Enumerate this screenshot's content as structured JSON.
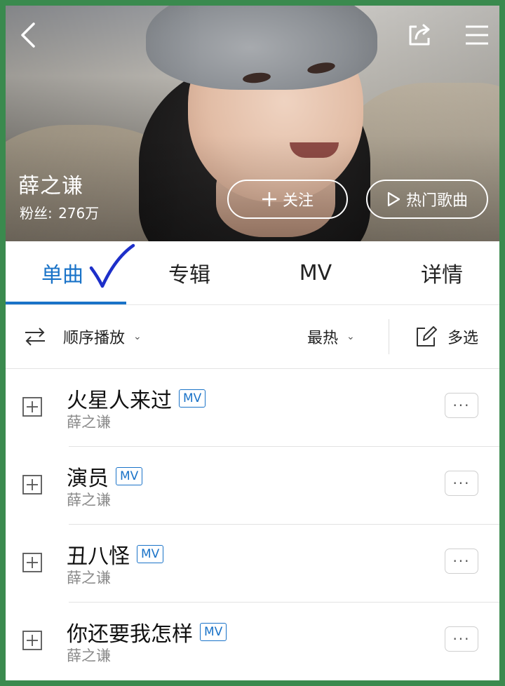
{
  "header": {
    "artist_name": "薛之谦",
    "fans_label": "粉丝:",
    "fans_count": "276万",
    "follow_label": "关注",
    "hot_songs_label": "热门歌曲",
    "icons": [
      "back-icon",
      "share-icon",
      "menu-icon"
    ]
  },
  "tabs": [
    {
      "label": "单曲",
      "active": true
    },
    {
      "label": "专辑",
      "active": false
    },
    {
      "label": "MV",
      "active": false
    },
    {
      "label": "详情",
      "active": false
    }
  ],
  "toolbar": {
    "play_order_label": "顺序播放",
    "sort_label": "最热",
    "multi_select_label": "多选"
  },
  "songs": [
    {
      "title": "火星人来过",
      "badge": "MV",
      "artist": "薛之谦"
    },
    {
      "title": "演员",
      "badge": "MV",
      "artist": "薛之谦"
    },
    {
      "title": "丑八怪",
      "badge": "MV",
      "artist": "薛之谦"
    },
    {
      "title": "你还要我怎样",
      "badge": "MV",
      "artist": "薛之谦"
    }
  ],
  "colors": {
    "accent": "#1a73c8",
    "frame": "#3a8a4e"
  }
}
